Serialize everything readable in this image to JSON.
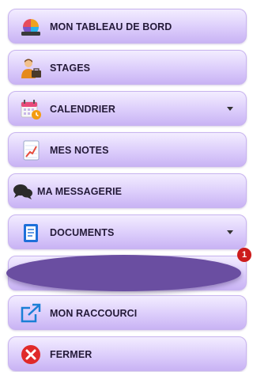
{
  "menu": {
    "dashboard": {
      "label": "MON TABLEAU DE BORD",
      "icon": "dashboard-chart-icon"
    },
    "stages": {
      "label": "STAGES",
      "icon": "person-briefcase-icon"
    },
    "calendar": {
      "label": "CALENDRIER",
      "icon": "calendar-icon",
      "dropdown": true
    },
    "notes": {
      "label": "MES NOTES",
      "icon": "grades-chart-icon"
    },
    "messaging": {
      "label": "MA MESSAGERIE",
      "icon": "chat-bubbles-icon"
    },
    "documents": {
      "label": "DOCUMENTS",
      "icon": "document-icon",
      "dropdown": true
    },
    "redacted": {
      "badge": "1"
    },
    "shortcut": {
      "label": "MON RACCOURCI",
      "icon": "external-link-icon"
    },
    "close": {
      "label": "FERMER",
      "icon": "close-circle-icon"
    }
  },
  "colors": {
    "button_gradient_top": "#f3edff",
    "button_gradient_bottom": "#c9b3f4",
    "redaction": "#6a4ea1",
    "badge": "#cc1c1c",
    "close_red": "#e02a2a"
  }
}
